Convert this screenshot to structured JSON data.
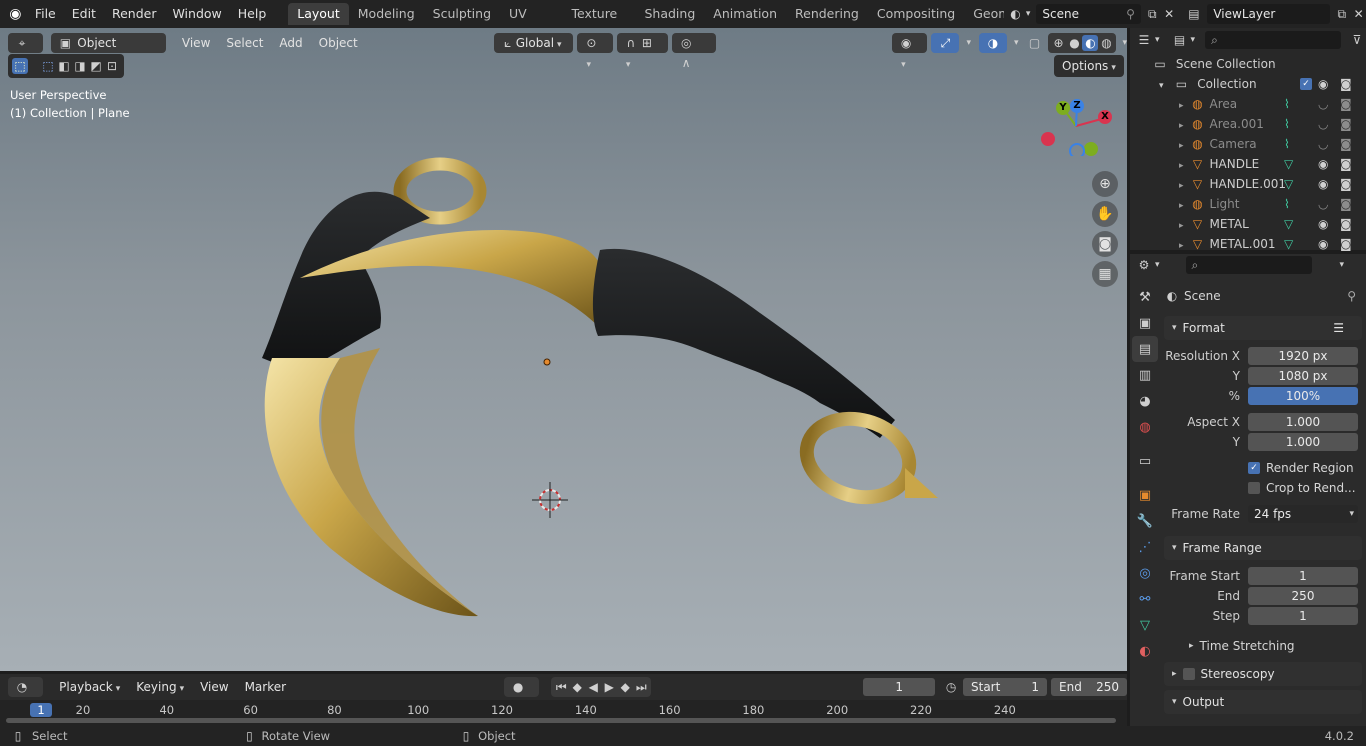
{
  "menu": [
    "File",
    "Edit",
    "Render",
    "Window",
    "Help"
  ],
  "workspaces": [
    "Layout",
    "Modeling",
    "Sculpting",
    "UV Editing",
    "Texture Paint",
    "Shading",
    "Animation",
    "Rendering",
    "Compositing",
    "Geomet"
  ],
  "scene_field": "Scene",
  "viewlayer_field": "ViewLayer",
  "viewport": {
    "mode": "Object Mode",
    "menus": [
      "View",
      "Select",
      "Add",
      "Object"
    ],
    "transform": "Global",
    "options": "Options",
    "perspective": "User Perspective",
    "collection_info": "(1) Collection | Plane",
    "gizmo": {
      "x": "X",
      "y": "Y",
      "z": "Z"
    }
  },
  "outliner": {
    "root": "Scene Collection",
    "collection": "Collection",
    "items": [
      {
        "name": "Area",
        "dim": true
      },
      {
        "name": "Area.001",
        "dim": true
      },
      {
        "name": "Camera",
        "dim": true
      },
      {
        "name": "HANDLE",
        "dim": false
      },
      {
        "name": "HANDLE.001",
        "dim": false
      },
      {
        "name": "Light",
        "dim": true
      },
      {
        "name": "METAL",
        "dim": false
      },
      {
        "name": "METAL.001",
        "dim": false
      }
    ]
  },
  "properties": {
    "context": "Scene",
    "format": {
      "title": "Format",
      "res_x_label": "Resolution X",
      "res_x": "1920 px",
      "res_y_label": "Y",
      "res_y": "1080 px",
      "pct_label": "%",
      "pct": "100%",
      "aspect_x_label": "Aspect X",
      "aspect_x": "1.000",
      "aspect_y_label": "Y",
      "aspect_y": "1.000",
      "render_region": "Render Region",
      "crop": "Crop to Rend...",
      "frame_rate_label": "Frame Rate",
      "frame_rate": "24 fps"
    },
    "frame_range": {
      "title": "Frame Range",
      "start_label": "Frame Start",
      "start": "1",
      "end_label": "End",
      "end": "250",
      "step_label": "Step",
      "step": "1",
      "time_stretching": "Time Stretching"
    },
    "stereoscopy": "Stereoscopy",
    "output": "Output"
  },
  "timeline": {
    "menus": [
      "Playback",
      "Keying",
      "View",
      "Marker"
    ],
    "current_frame": "1",
    "start_label": "Start",
    "start": "1",
    "end_label": "End",
    "end": "250",
    "ticks": [
      "1",
      "20",
      "40",
      "60",
      "80",
      "100",
      "120",
      "140",
      "160",
      "180",
      "200",
      "220",
      "240"
    ]
  },
  "status": {
    "select": "Select",
    "rotate": "Rotate View",
    "object": "Object",
    "version": "4.0.2"
  },
  "colors": {
    "accent": "#4772b3",
    "orange": "#e58a2e",
    "gizmo_x": "#d9344f",
    "gizmo_y": "#7dad1f",
    "gizmo_z": "#3a82e6"
  }
}
